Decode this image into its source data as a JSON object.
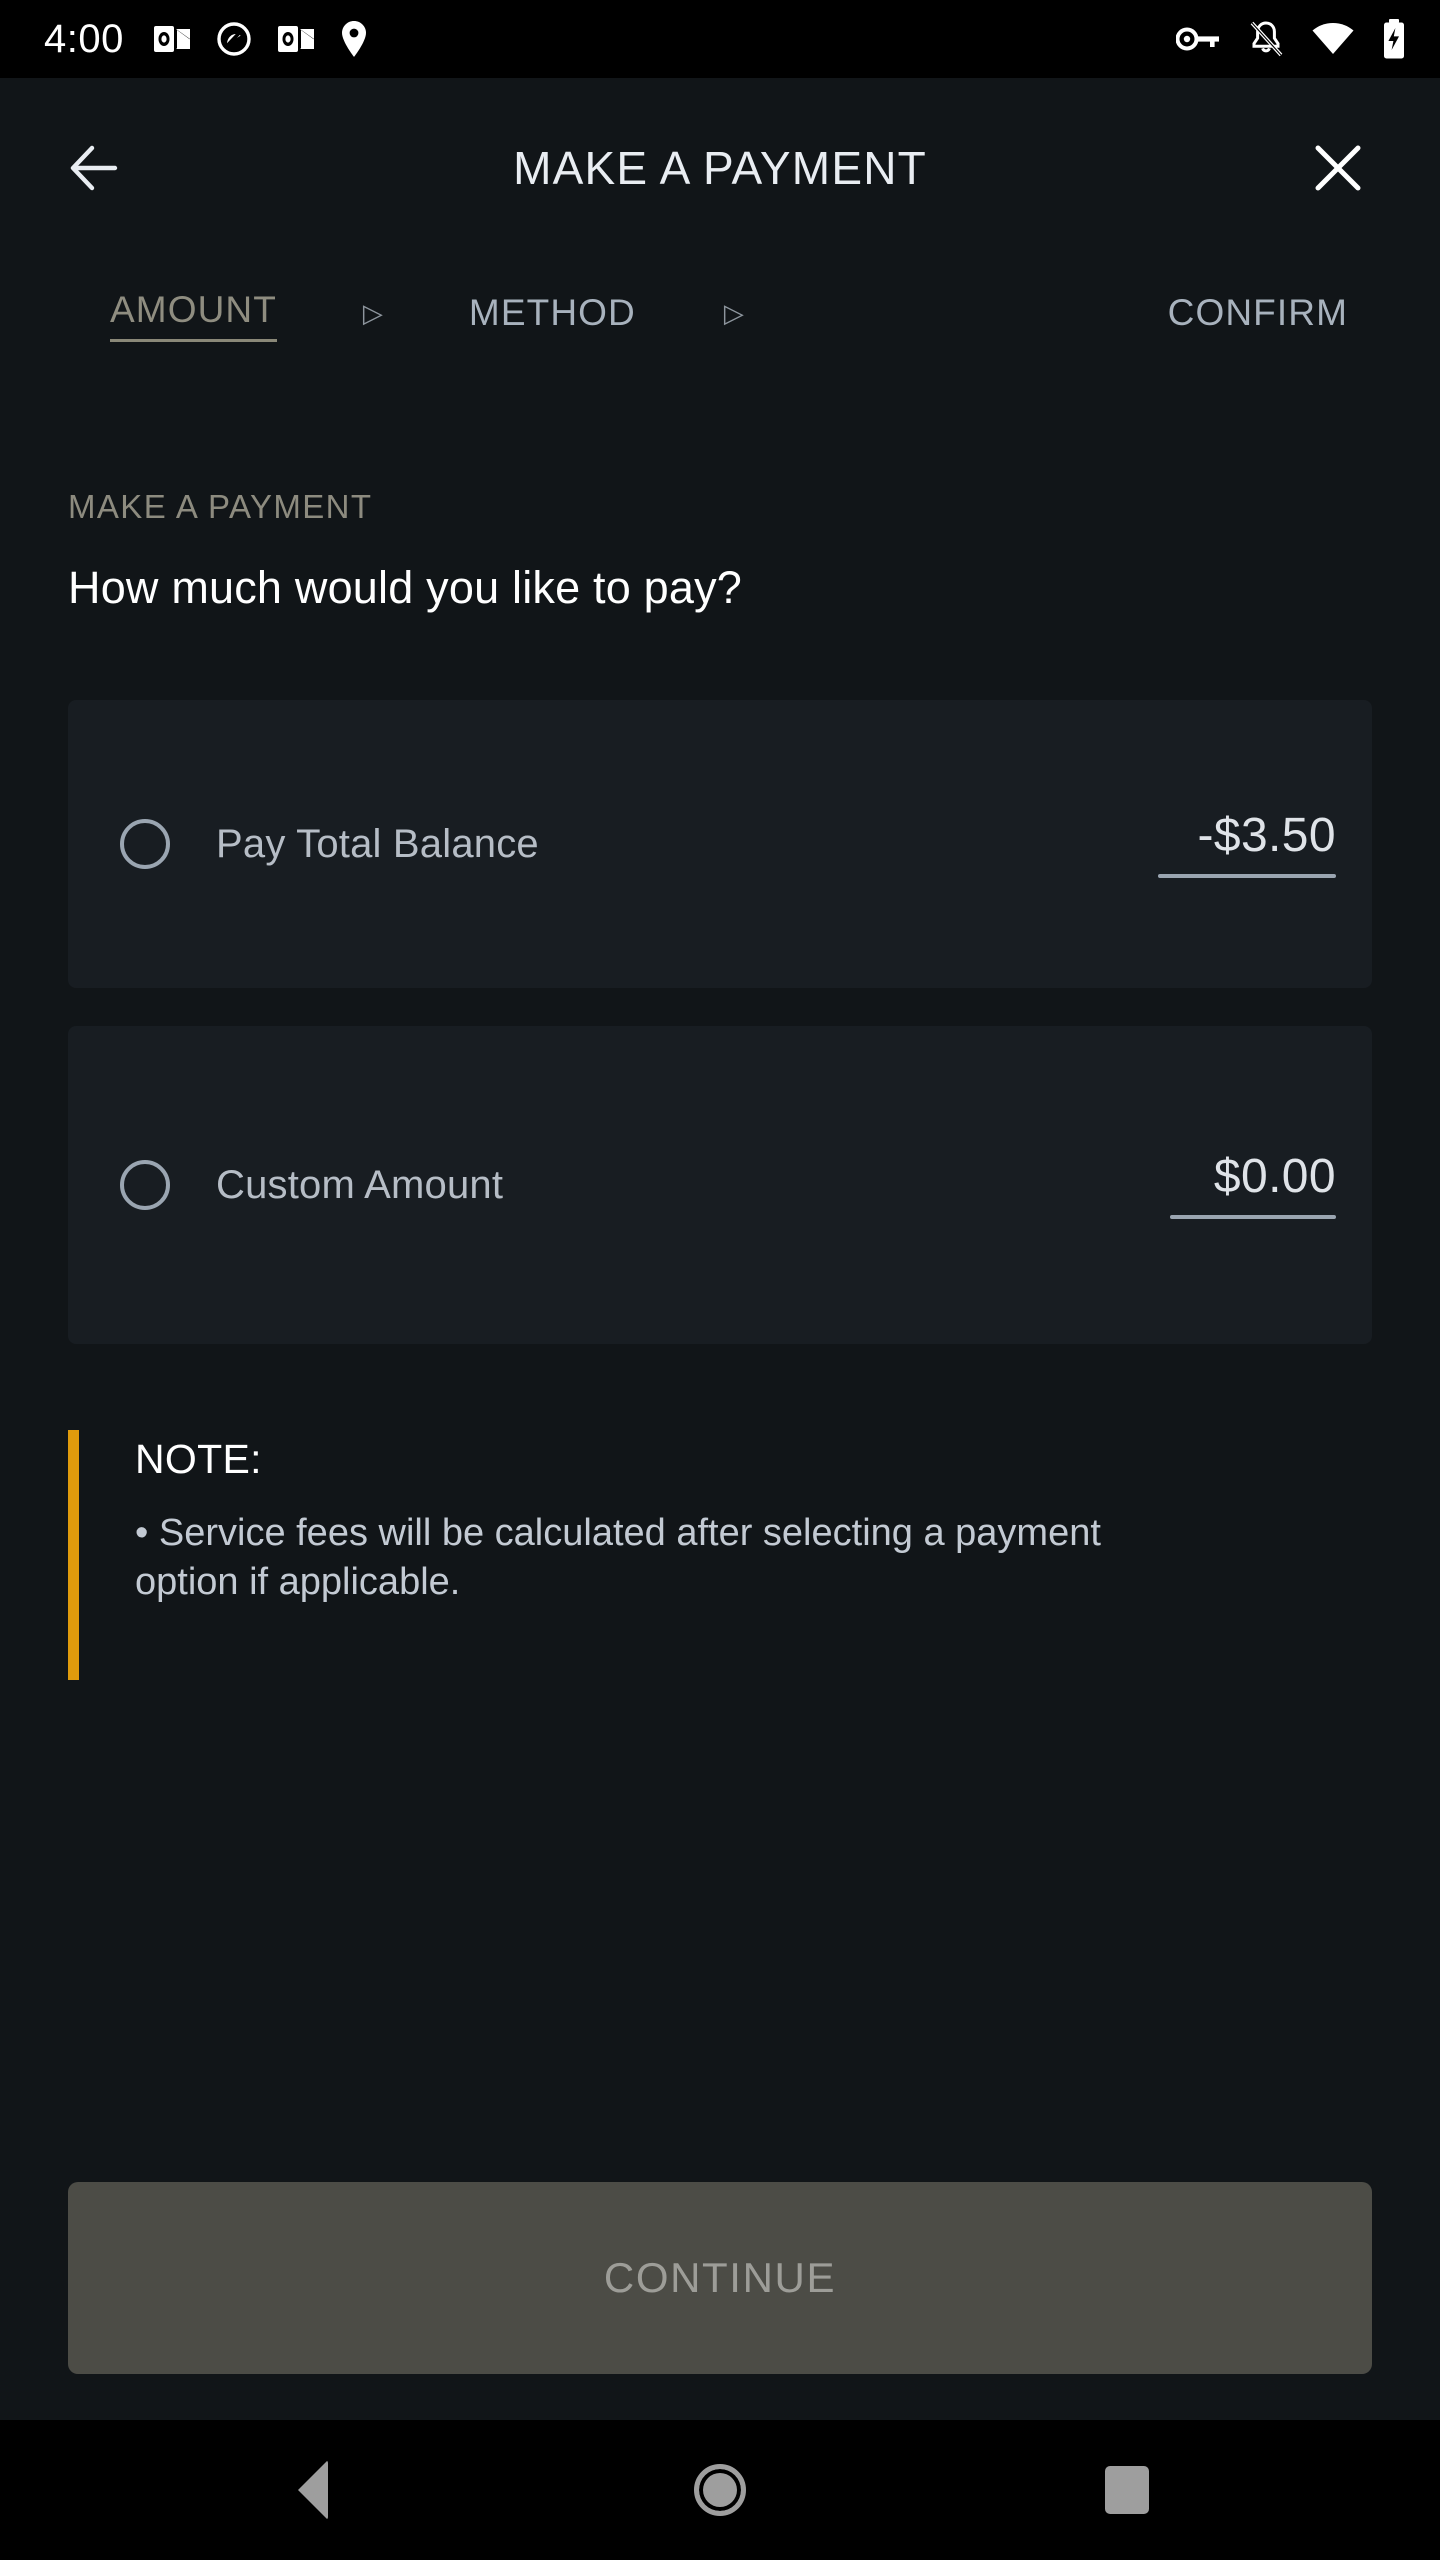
{
  "status_bar": {
    "time": "4:00",
    "left_icons": [
      "outlook-icon",
      "block-circle-icon",
      "outlook-icon",
      "location-pin-icon"
    ],
    "right_icons": [
      "vpn-key-icon",
      "notifications-off-icon",
      "wifi-icon",
      "battery-charging-icon"
    ]
  },
  "header": {
    "title": "MAKE A PAYMENT",
    "back_icon": "arrow-left-icon",
    "close_icon": "close-icon"
  },
  "stepper": {
    "separator": "▷",
    "steps": [
      {
        "label": "AMOUNT",
        "active": true
      },
      {
        "label": "METHOD",
        "active": false
      },
      {
        "label": "CONFIRM",
        "active": false
      }
    ]
  },
  "main": {
    "eyebrow": "MAKE A PAYMENT",
    "headline": "How much would you like to pay?",
    "options": [
      {
        "label": "Pay Total Balance",
        "amount": "-$3.50",
        "selected": false,
        "radio_icon": "radio-unchecked-icon"
      },
      {
        "label": "Custom Amount",
        "amount": "$0.00",
        "selected": false,
        "radio_icon": "radio-unchecked-icon"
      }
    ],
    "note": {
      "title": "NOTE:",
      "body": "• Service fees will be calculated after selecting a payment option if applicable.",
      "accent_color": "#e09b0c"
    }
  },
  "footer": {
    "continue_label": "CONTINUE",
    "continue_enabled": false
  },
  "nav_bar": {
    "back": "nav-back-icon",
    "home": "nav-home-icon",
    "recents": "nav-recents-icon"
  },
  "colors": {
    "page_background": "#111518",
    "card_background": "#181d22",
    "accent_amber": "#e09b0c",
    "disabled_button": "#4c4c46",
    "text_primary": "#ffffff",
    "text_secondary": "#b6bdc6",
    "step_active": "#8f8d80"
  }
}
